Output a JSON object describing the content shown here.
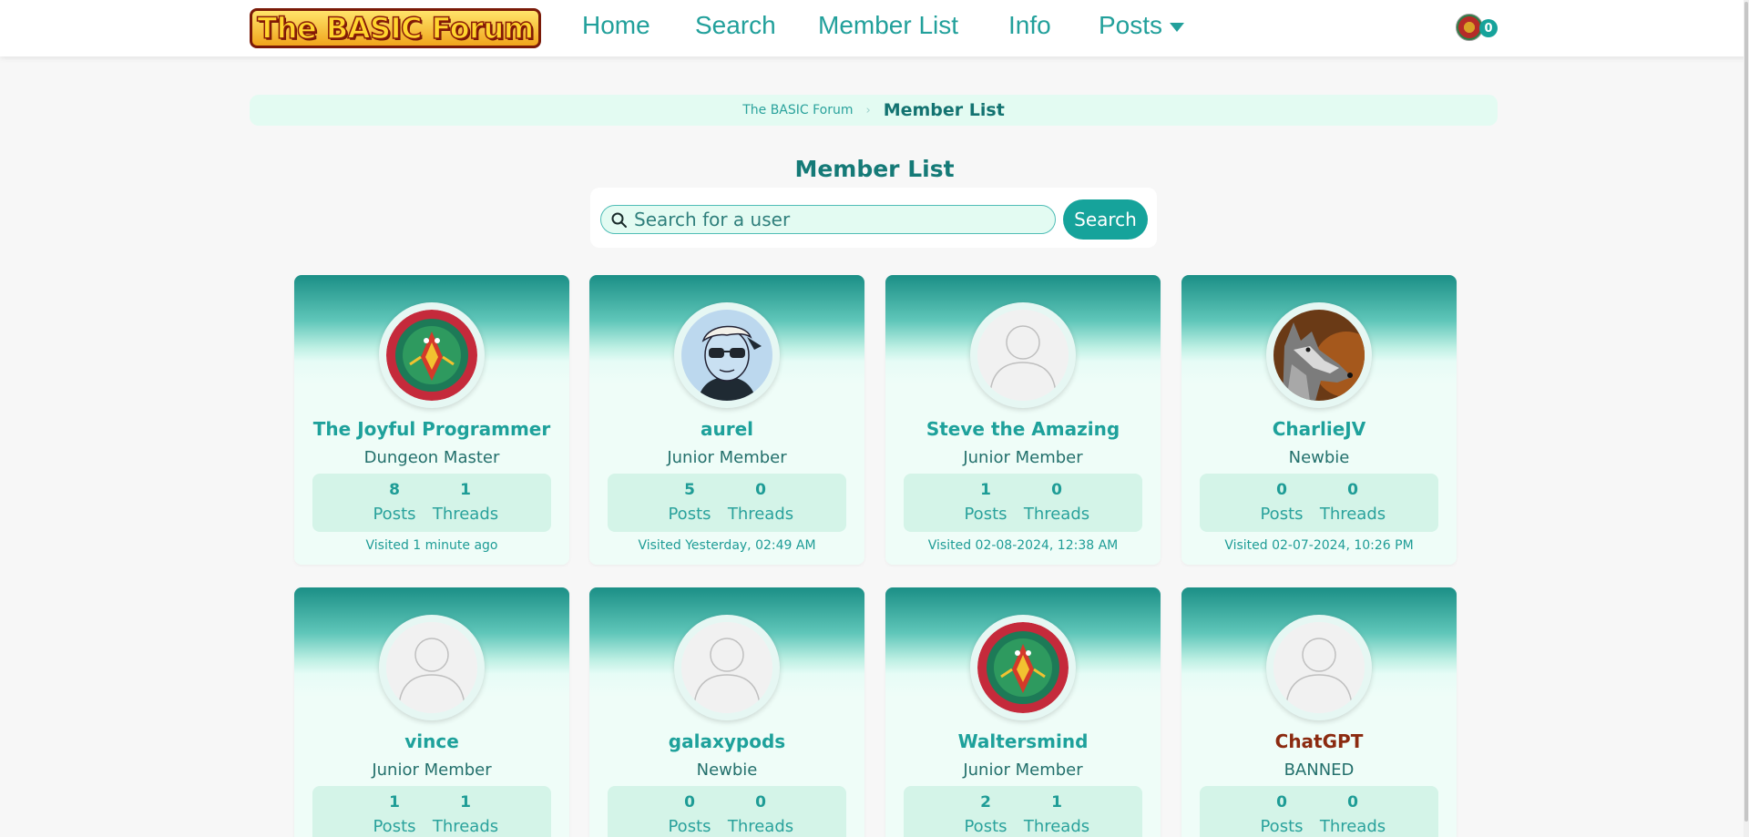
{
  "header": {
    "logo_text": "The BASIC Forum",
    "nav": [
      {
        "label": "Home"
      },
      {
        "label": "Search"
      },
      {
        "label": "Member List"
      },
      {
        "label": "Info"
      },
      {
        "label": "Posts"
      }
    ],
    "notification_count": "0"
  },
  "breadcrumb": {
    "home": "The BASIC Forum",
    "separator": "›",
    "current": "Member List"
  },
  "page_title": "Member List",
  "search": {
    "placeholder": "Search for a user",
    "value": "",
    "button_label": "Search"
  },
  "stat_labels": {
    "posts": "Posts",
    "threads": "Threads"
  },
  "members": [
    {
      "name": "The Joyful Programmer",
      "rank": "Dungeon Master",
      "posts": "8",
      "threads": "1",
      "visited": "Visited 1 minute ago",
      "avatar": "joyful-programmer-logo",
      "banned": false
    },
    {
      "name": "aurel",
      "rank": "Junior Member",
      "posts": "5",
      "threads": "0",
      "visited": "Visited Yesterday, 02:49 AM",
      "avatar": "sunglasses-man",
      "banned": false
    },
    {
      "name": "Steve the Amazing",
      "rank": "Junior Member",
      "posts": "1",
      "threads": "0",
      "visited": "Visited 02-08-2024, 12:38 AM",
      "avatar": "default-user",
      "banned": false
    },
    {
      "name": "CharlieJV",
      "rank": "Newbie",
      "posts": "0",
      "threads": "0",
      "visited": "Visited 02-07-2024, 10:26 PM",
      "avatar": "wolf",
      "banned": false
    },
    {
      "name": "vince",
      "rank": "Junior Member",
      "posts": "1",
      "threads": "1",
      "visited": "",
      "avatar": "default-user",
      "banned": false
    },
    {
      "name": "galaxypods",
      "rank": "Newbie",
      "posts": "0",
      "threads": "0",
      "visited": "",
      "avatar": "default-user",
      "banned": false
    },
    {
      "name": "Waltersmind",
      "rank": "Junior Member",
      "posts": "2",
      "threads": "1",
      "visited": "",
      "avatar": "joyful-programmer-logo",
      "banned": false
    },
    {
      "name": "ChatGPT",
      "rank": "BANNED",
      "posts": "0",
      "threads": "0",
      "visited": "",
      "avatar": "default-user",
      "banned": true
    }
  ],
  "colors": {
    "accent": "#16a39b",
    "nav_text": "#22a09b",
    "banned": "#8b2a10",
    "card_header": "#1b8f86"
  }
}
